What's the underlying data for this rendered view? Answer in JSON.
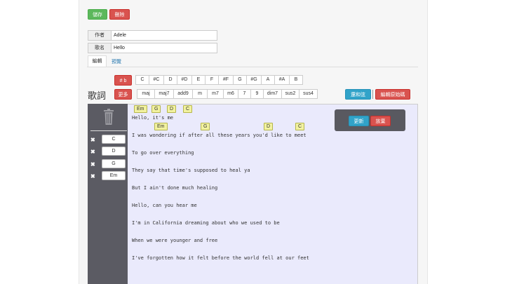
{
  "toolbar": {
    "save_label": "儲存",
    "delete_label": "刪除"
  },
  "form": {
    "author_label": "作者",
    "author_value": "Adele",
    "title_label": "歌名",
    "title_value": "Hello"
  },
  "tabs": [
    {
      "label": "編輯",
      "active": true
    },
    {
      "label": "預覽",
      "active": false
    }
  ],
  "key_toggle": "# b",
  "roots": [
    "C",
    "#C",
    "D",
    "#D",
    "E",
    "F",
    "#F",
    "G",
    "#G",
    "A",
    "#A",
    "B"
  ],
  "more_label": "更多",
  "qualities": [
    "maj",
    "maj7",
    "add9",
    "m",
    "m7",
    "m6",
    "7",
    "9",
    "dim7",
    "sus2",
    "sus4"
  ],
  "chord_action_blue": "還和弦",
  "chord_action_red": "編輯原始碼",
  "lyrics_title": "歌詞",
  "sidebar_chords": [
    "C",
    "D",
    "G",
    "Em"
  ],
  "chips": [
    "Em",
    "G",
    "D",
    "C"
  ],
  "lyric_lines": [
    "Hello, it's me",
    "I was wondering if after all these years you'd like to meet",
    "To go over everything",
    "They say that time's supposed to heal ya",
    "But I ain't done much healing",
    "Hello, can you hear me",
    "I'm in California dreaming about who we used to be",
    "When we were younger and free",
    "I've forgotten how it felt before the world fell at our feet"
  ],
  "popup": {
    "update_label": "更新",
    "cancel_label": "放棄"
  },
  "colors": {
    "sidebar_bg": "#5b5b63",
    "editor_bg": "#eaeafc",
    "chip_bg": "#f2f2a0"
  }
}
